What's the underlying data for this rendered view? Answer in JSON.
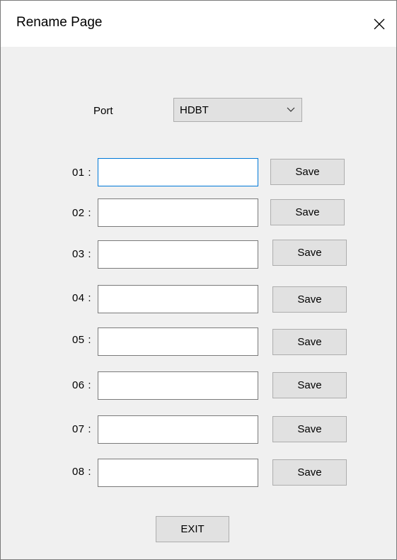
{
  "window": {
    "title": "Rename Page"
  },
  "port": {
    "label": "Port",
    "selected": "HDBT"
  },
  "rows": [
    {
      "label": "01 :",
      "value": "",
      "save_label": "Save"
    },
    {
      "label": "02 :",
      "value": "",
      "save_label": "Save"
    },
    {
      "label": "03 :",
      "value": "",
      "save_label": "Save"
    },
    {
      "label": "04 :",
      "value": "",
      "save_label": "Save"
    },
    {
      "label": "05 :",
      "value": "",
      "save_label": "Save"
    },
    {
      "label": "06 :",
      "value": "",
      "save_label": "Save"
    },
    {
      "label": "07 :",
      "value": "",
      "save_label": "Save"
    },
    {
      "label": "08 :",
      "value": "",
      "save_label": "Save"
    }
  ],
  "footer": {
    "exit_label": "EXIT"
  },
  "icons": {
    "close": "close-icon",
    "dropdown": "chevron-down-icon"
  },
  "colors": {
    "focus_border": "#0078d7",
    "button_bg": "#e1e1e1",
    "dialog_bg": "#f0f0f0"
  }
}
